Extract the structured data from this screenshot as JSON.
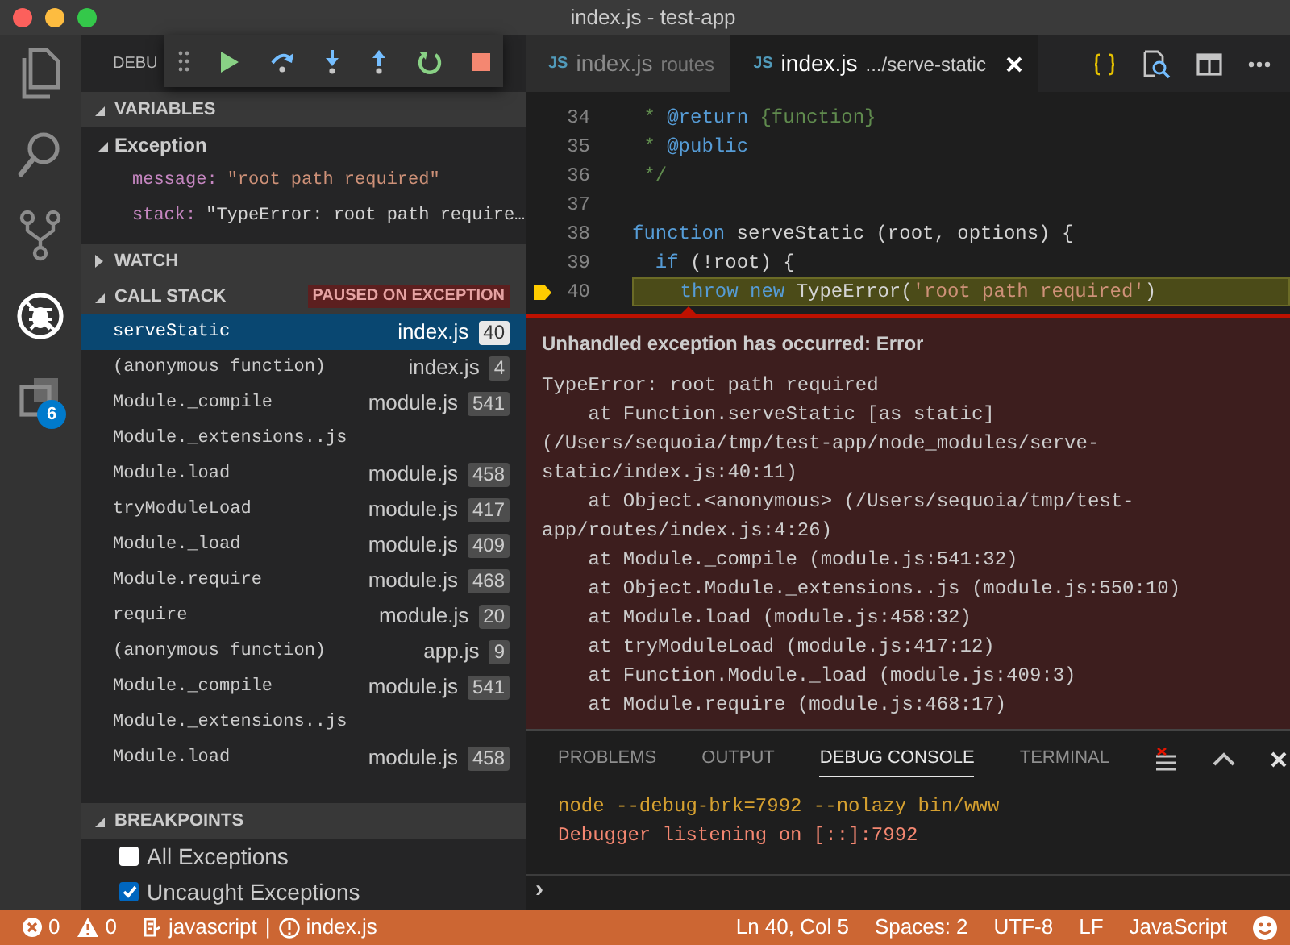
{
  "window": {
    "title": "index.js - test-app"
  },
  "activity_bar": {
    "items": [
      {
        "kind": "explorer",
        "selected": false
      },
      {
        "kind": "search",
        "selected": false
      },
      {
        "kind": "git",
        "selected": false
      },
      {
        "kind": "debug",
        "selected": true
      },
      {
        "kind": "extensions",
        "selected": false,
        "badge": "6"
      }
    ]
  },
  "sidebar": {
    "title": "DEBU",
    "variables": {
      "title": "VARIABLES",
      "expanded": true,
      "scopes": [
        {
          "label": "Exception",
          "expanded": true,
          "children": [
            {
              "name": "message:",
              "value": "\"root path required\""
            },
            {
              "name": "stack:",
              "value": "\"TypeError: root path require…"
            }
          ]
        }
      ]
    },
    "watch": {
      "title": "WATCH",
      "expanded": false
    },
    "call_stack": {
      "title": "CALL STACK",
      "expanded": true,
      "badge": "PAUSED ON EXCEPTION",
      "frames": [
        {
          "name": "serveStatic",
          "file": "index.js",
          "line": "40",
          "selected": true
        },
        {
          "name": "(anonymous function)",
          "file": "index.js",
          "line": "4",
          "selected": false
        },
        {
          "name": "Module._compile",
          "file": "module.js",
          "line": "541",
          "selected": false
        },
        {
          "name": "Module._extensions..js",
          "selected": false
        },
        {
          "name": "Module.load",
          "file": "module.js",
          "line": "458",
          "selected": false
        },
        {
          "name": "tryModuleLoad",
          "file": "module.js",
          "line": "417",
          "selected": false
        },
        {
          "name": "Module._load",
          "file": "module.js",
          "line": "409",
          "selected": false
        },
        {
          "name": "Module.require",
          "file": "module.js",
          "line": "468",
          "selected": false
        },
        {
          "name": "require",
          "file": "module.js",
          "line": "20",
          "selected": false
        },
        {
          "name": "(anonymous function)",
          "file": "app.js",
          "line": "9",
          "selected": false
        },
        {
          "name": "Module._compile",
          "file": "module.js",
          "line": "541",
          "selected": false
        },
        {
          "name": "Module._extensions..js",
          "selected": false
        },
        {
          "name": "Module.load",
          "file": "module.js",
          "line": "458",
          "selected": false
        }
      ]
    },
    "breakpoints": {
      "title": "BREAKPOINTS",
      "expanded": true,
      "items": [
        {
          "label": "All Exceptions",
          "checked": false
        },
        {
          "label": "Uncaught Exceptions",
          "checked": true
        }
      ]
    }
  },
  "editor": {
    "tabs": [
      {
        "icon": "JS",
        "label": "index.js",
        "description": "routes",
        "selected": false
      },
      {
        "icon": "JS",
        "label": "index.js",
        "description": ".../serve-static",
        "selected": true
      }
    ],
    "lines": [
      {
        "number": "34",
        "current": false,
        "tokens": [
          {
            "text": " * ",
            "kind": "comment"
          },
          {
            "text": "@return",
            "kind": "tag"
          },
          {
            "text": " {function}",
            "kind": "comment"
          }
        ]
      },
      {
        "number": "35",
        "current": false,
        "tokens": [
          {
            "text": " * ",
            "kind": "comment"
          },
          {
            "text": "@public",
            "kind": "tag"
          }
        ]
      },
      {
        "number": "36",
        "current": false,
        "tokens": [
          {
            "text": " */",
            "kind": "comment"
          }
        ]
      },
      {
        "number": "37",
        "current": false
      },
      {
        "number": "38",
        "current": false,
        "tokens": [
          {
            "text": "function",
            "kind": "keyword"
          },
          {
            "text": " serveStatic (root, options) {",
            "kind": "plain"
          }
        ]
      },
      {
        "number": "39",
        "current": false,
        "tokens": [
          {
            "text": "  if",
            "kind": "keyword"
          },
          {
            "text": " (!root) {",
            "kind": "plain"
          }
        ]
      },
      {
        "number": "40",
        "current": true,
        "tokens": [
          {
            "text": "    throw new",
            "kind": "keyword"
          },
          {
            "text": " TypeError(",
            "kind": "plain"
          },
          {
            "text": "'root path required'",
            "kind": "string"
          },
          {
            "text": ")",
            "kind": "plain"
          }
        ]
      }
    ],
    "exception": {
      "title": "Unhandled exception has occurred: Error",
      "lines": [
        "TypeError: root path required",
        "    at Function.serveStatic [as static]",
        "(/Users/sequoia/tmp/test-app/node_modules/serve-",
        "static/index.js:40:11)",
        "    at Object.<anonymous> (/Users/sequoia/tmp/test-",
        "app/routes/index.js:4:26)",
        "    at Module._compile (module.js:541:32)",
        "    at Object.Module._extensions..js (module.js:550:10)",
        "    at Module.load (module.js:458:32)",
        "    at tryModuleLoad (module.js:417:12)",
        "    at Function.Module._load (module.js:409:3)",
        "    at Module.require (module.js:468:17)"
      ]
    }
  },
  "panel": {
    "tabs": [
      {
        "label": "PROBLEMS",
        "selected": false
      },
      {
        "label": "OUTPUT",
        "selected": false
      },
      {
        "label": "DEBUG CONSOLE",
        "selected": true
      },
      {
        "label": "TERMINAL",
        "selected": false
      }
    ],
    "console": [
      {
        "kind": "command",
        "text": "node --debug-brk=7992 --nolazy bin/www"
      },
      {
        "kind": "info",
        "text": "Debugger listening on [::]:7992"
      }
    ],
    "prompt": "›"
  },
  "status_bar": {
    "left": [
      {
        "kind": "errors",
        "text": "0"
      },
      {
        "kind": "warnings",
        "text": "0"
      },
      {
        "kind": "language",
        "text": "javascript"
      },
      {
        "kind": "separator",
        "text": "|"
      },
      {
        "kind": "file",
        "text": "index.js"
      }
    ],
    "right": [
      "Ln 40, Col 5",
      "Spaces: 2",
      "UTF-8",
      "LF",
      "JavaScript"
    ]
  }
}
